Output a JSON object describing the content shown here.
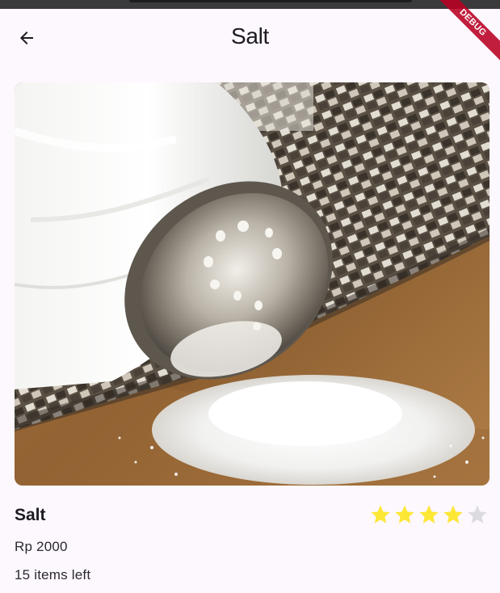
{
  "app_bar": {
    "title": "Salt",
    "back_icon": "arrow-left-icon"
  },
  "debug_banner": {
    "label": "DEBUG"
  },
  "product": {
    "image_icon": "salt-shaker-photo",
    "name": "Salt",
    "price": "Rp 2000",
    "stock": "15 items left",
    "rating": 4,
    "rating_max": 5
  },
  "colors": {
    "background": "#fdf7fe",
    "star_filled": "#fde735",
    "star_empty": "#dcdce0",
    "debug_ribbon": "#b80022"
  }
}
